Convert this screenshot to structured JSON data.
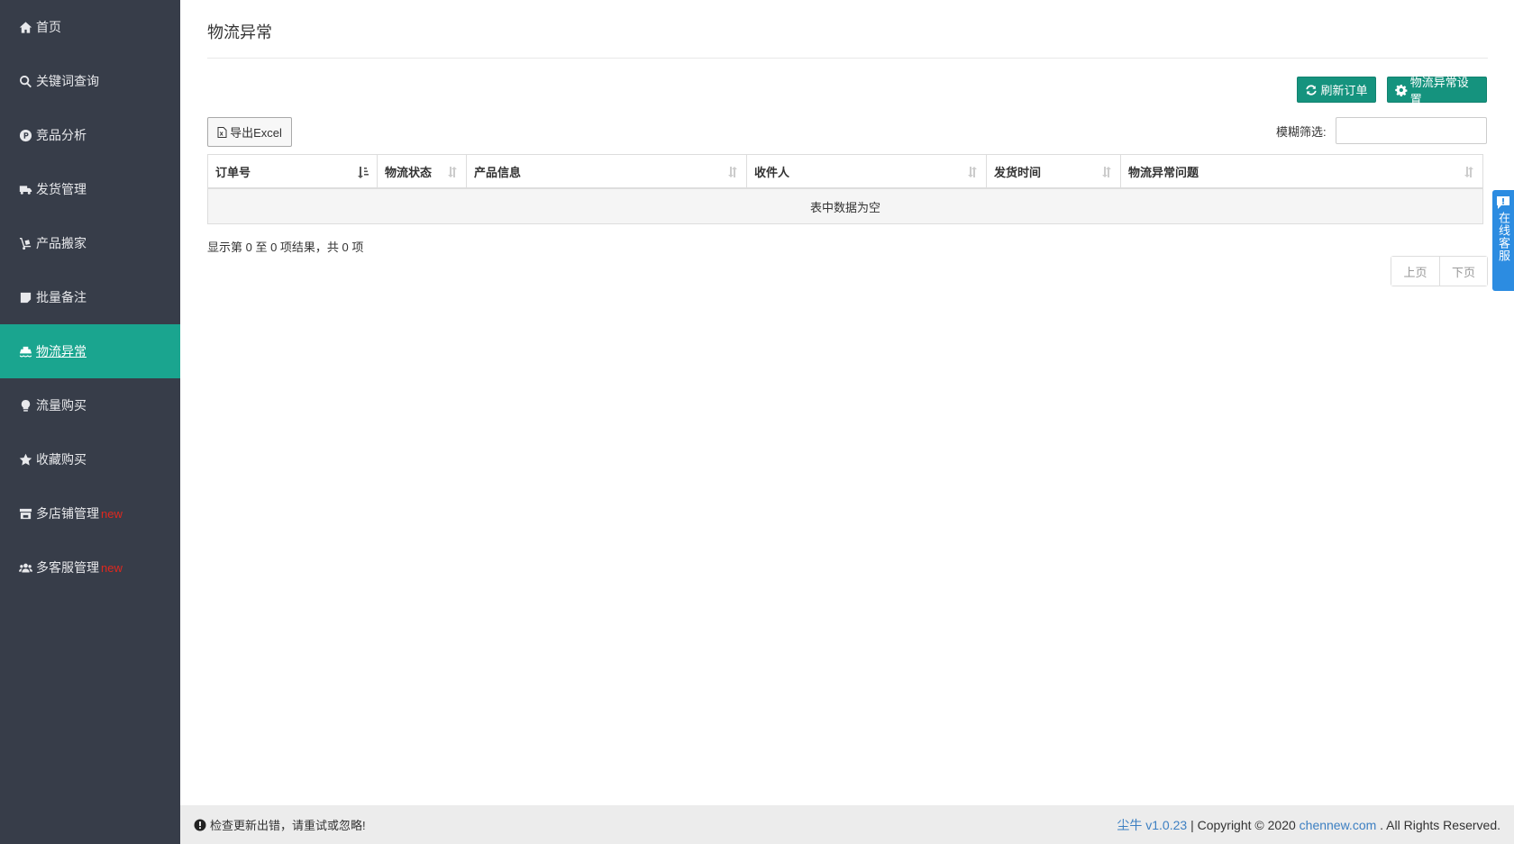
{
  "sidebar": {
    "items": [
      {
        "label": "首页",
        "icon": "home-icon"
      },
      {
        "label": "关键词查询",
        "icon": "search-icon"
      },
      {
        "label": "竞品分析",
        "icon": "p-circle-icon"
      },
      {
        "label": "发货管理",
        "icon": "truck-icon"
      },
      {
        "label": "产品搬家",
        "icon": "dolly-icon"
      },
      {
        "label": "批量备注",
        "icon": "note-icon"
      },
      {
        "label": "物流异常",
        "icon": "ship-icon",
        "active": true
      },
      {
        "label": "流量购买",
        "icon": "bulb-icon"
      },
      {
        "label": "收藏购买",
        "icon": "star-icon"
      },
      {
        "label": "多店铺管理",
        "icon": "store-icon",
        "badge": "new"
      },
      {
        "label": "多客服管理",
        "icon": "users-icon",
        "badge": "new"
      }
    ],
    "active_color": "#1aa58f",
    "bg_color": "#373d49"
  },
  "page": {
    "title": "物流异常"
  },
  "toolbar": {
    "refresh_label": "刷新订单",
    "settings_label": "物流异常设置",
    "export_label": "导出Excel",
    "filter_label": "模糊筛选:",
    "filter_value": ""
  },
  "table": {
    "columns": [
      "订单号",
      "物流状态",
      "产品信息",
      "收件人",
      "发货时间",
      "物流异常问题"
    ],
    "empty_text": "表中数据为空"
  },
  "pagination": {
    "info": "显示第 0 至 0 项结果，共 0 项",
    "prev_label": "上页",
    "next_label": "下页"
  },
  "footer": {
    "notice": "检查更新出错，请重试或忽略!",
    "brand": "尘牛 v1.0.23",
    "copyright_prefix": " | Copyright © 2020 ",
    "site": "chennew.com",
    "suffix": " . All Rights Reserved."
  },
  "service_tab": {
    "label": "在线客服"
  }
}
